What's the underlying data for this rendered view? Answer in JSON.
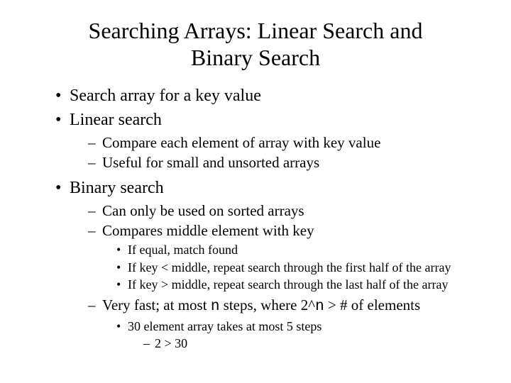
{
  "title": "Searching Arrays: Linear Search and Binary Search",
  "b1": "Search array for a key value",
  "b2": "Linear search",
  "b2s1": "Compare each element of array with key value",
  "b2s2": "Useful for small and unsorted arrays",
  "b3": "Binary search",
  "b3s1": "Can only be used on sorted arrays",
  "b3s2": "Compares middle element with key",
  "b3s2a": "If equal, match found",
  "b3s2b": "If key < middle, repeat search through the first half of the array",
  "b3s2c": "If key > middle, repeat search through the last half of the array",
  "b3s3_pre": "Very fast; at most ",
  "b3s3_n": "n",
  "b3s3_mid": " steps, where 2^",
  "b3s3_n2": "n",
  "b3s3_post": "  > # of elements",
  "b3s3a": "30 element array takes at most 5 steps",
  "b3s3a1": "2   > 30"
}
